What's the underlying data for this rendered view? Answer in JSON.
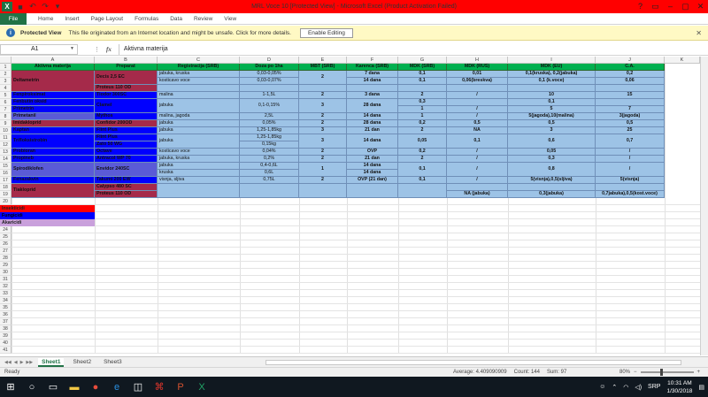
{
  "window": {
    "title": "MRL Voce 10  [Protected View]  -  Microsoft Excel (Product Activation Failed)",
    "controls": [
      "?",
      "▭",
      "–",
      "▢",
      "✕"
    ]
  },
  "ribbon": {
    "file_label": "File",
    "tabs": [
      "Home",
      "Insert",
      "Page Layout",
      "Formulas",
      "Data",
      "Review",
      "View"
    ]
  },
  "protected_view": {
    "label": "Protected View",
    "message": "This file originated from an Internet location and might be unsafe. Click for more details.",
    "button": "Enable Editing",
    "close": "✕"
  },
  "formula_bar": {
    "name_box": "A1",
    "fx": "fx",
    "formula": "Aktivna materija"
  },
  "columns": [
    "A",
    "B",
    "C",
    "D",
    "E",
    "F",
    "G",
    "H",
    "I",
    "J",
    "K"
  ],
  "rows": [
    "1",
    "2",
    "3",
    "4",
    "5",
    "6",
    "7",
    "8",
    "9",
    "10",
    "11",
    "12",
    "13",
    "14",
    "15",
    "16",
    "17",
    "18",
    "19",
    "20",
    "21",
    "22",
    "23",
    "24",
    "25",
    "26",
    "27",
    "28",
    "29",
    "30",
    "31",
    "32",
    "33",
    "34",
    "35",
    "36",
    "37",
    "38",
    "39",
    "40",
    "41"
  ],
  "table": {
    "headers": [
      "Aktivna materija",
      "Preparat",
      "Registracija (SRB)",
      "Doza po 1ha",
      "MBT (SRB)",
      "Karenca (SRB)",
      "MDK (SRB)",
      "MDK (RUS)",
      "MDK (EU)",
      "C.A."
    ],
    "cells": {
      "A2": "Deltametrin",
      "B2": "Decis 2,5 EC",
      "C2": "jabuka, kruska",
      "D2": "0,03-0,05%",
      "E2": "2",
      "F2": "7 dana",
      "G2": "0,1",
      "H2": "0,01",
      "I2": "0,1(kruska), 0,2(jabuka)",
      "J2": "0,2",
      "C3": "kosticavo voce",
      "D3": "0,03-0,07%",
      "F3": "14 dana",
      "G3": "0,1",
      "H3": "0,06(breskva)",
      "I3": "0,1 (k.voce)",
      "J3": "0,06",
      "B4": "Proteus 110 OD",
      "A5": "Fenpiroksimat",
      "B5": "Tiodor 300SC",
      "C5": "malina",
      "D5": "1-1,5L",
      "E5": "2",
      "F5": "3 dana",
      "G5": "2",
      "H5": "/",
      "I5": "10",
      "J5": "15",
      "A6": "Fenbutin oksid",
      "G6": "0,3",
      "I6": "0,1",
      "A7": "Primetrin",
      "B7": "Clamel",
      "C7": "jabuka",
      "D7": "0,1-0,15%",
      "E7": "3",
      "F7": "28 dana",
      "G7": "1",
      "H7": "/",
      "I7": "5",
      "J7": "7",
      "A8": "Primetanil",
      "B8": "Mythos",
      "C8": "malina, jagoda",
      "D8": "2,5L",
      "E8": "2",
      "F8": "14 dana",
      "G8": "1",
      "H8": "/",
      "I8": "5(jagoda),10(malina)",
      "J8": "3(jagoda)",
      "A9": "Imidakloprid",
      "B9": "Confidor 200OD",
      "C9": "jabuka",
      "D9": "0,05%",
      "E9": "2",
      "F9": "28 dana",
      "G9": "0,2",
      "H9": "0,5",
      "I9": "0,5",
      "J9": "0,5",
      "A10": "Kaptan",
      "B10": "Flint Plus",
      "C10": "jabuka",
      "D10": "1,25-1,85kg",
      "E10": "3",
      "F10": "21 dan",
      "G10": "2",
      "H10": "NA",
      "I10": "3",
      "J10": "25",
      "A11": "Trifloksistrobin",
      "B11": "Flint Plus",
      "C11": "jabuka",
      "D11": "1,25-1,85kg",
      "E11": "3",
      "F11": "14 dana",
      "G11": "0,05",
      "H11": "0,1",
      "I11": "0,6",
      "J11": "0,7",
      "B12": "Zato 50 WG",
      "D12": "0,15kg",
      "A13": "Probioran",
      "B13": "Octave",
      "C13": "kosticavo voce",
      "D13": "0,04%",
      "E13": "2",
      "F13": "OVP",
      "G13": "0,2",
      "H13": "/",
      "I13": "0,05",
      "J13": "/",
      "A14": "Propineb",
      "B14": "Antracol WP 70",
      "C14": "jabuka, kruska",
      "D14": "0,2%",
      "E14": "2",
      "F14": "21 dan",
      "G14": "2",
      "H14": "/",
      "I14": "0,3",
      "J14": "/",
      "A15": "Spirodiklofen",
      "B15": "Envidor 240SC",
      "C15": "jabuka",
      "D15": "0,4-0,6L",
      "E15": "1",
      "F15": "14 dana",
      "G15": "0,1",
      "H15": "/",
      "I15": "0,8",
      "J15": "/",
      "C16": "kruska",
      "D16": "0,6L",
      "F16": "14 dana",
      "A17": "Fenazakvin",
      "B17": "Takumi 200 EW",
      "C17": "visnja, sljiva",
      "D17": "0,75L",
      "E17": "2",
      "F17": "OVP (21 dan)",
      "G17": "0,1",
      "H17": "/",
      "I17": "5(visnja),0,5(sljiva)",
      "J17": "5(visnja)",
      "A18": "Tiakloprid",
      "B18": "Calypso 480 SC",
      "H19": "NA (jabuka)",
      "I19": "0,3(jabuka)",
      "J19": "0,7jabuka),0,5(kost.voce)",
      "B19": "Proteus 110 OD"
    }
  },
  "legend": [
    {
      "label": "Insekticidi",
      "color": "#ff0000"
    },
    {
      "label": "Fungicidi",
      "color": "#0000ff"
    },
    {
      "label": "Akaricidi",
      "color": "#c9a0dc"
    }
  ],
  "sheets": [
    "Sheet1",
    "Sheet2",
    "Sheet3"
  ],
  "status": {
    "ready": "Ready",
    "average": "Average: 4.409090909",
    "count": "Count: 144",
    "sum": "Sum: 97",
    "zoom": "80%"
  },
  "taskbar": {
    "time": "10:31 AM",
    "date": "1/30/2018",
    "lang": "SRP"
  }
}
